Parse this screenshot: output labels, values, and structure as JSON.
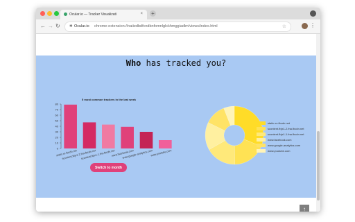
{
  "browser": {
    "tab_title": "Ocular.io — Tracker Visualizati",
    "tab_close": "×",
    "new_tab": "+",
    "omnibox_site": "Ocular.io",
    "omnibox_url": "chrome-extension://naiiedbdfcndbnfomnlglckhmggiadlm/views/index.html",
    "back": "←",
    "forward": "→",
    "reload": "↻",
    "star": "☆",
    "menu": "⋮"
  },
  "page": {
    "headline_bold": "Who",
    "headline_rest": " has tracked you?",
    "switch_button": "Switch to month",
    "scroll_top": "↑"
  },
  "colors": {
    "panel_bg": "#a9c9f3",
    "button": "#e0417a"
  },
  "chart_data": [
    {
      "type": "bar",
      "title": "5 most common trackers in the last week",
      "categories": [
        "static.xx.fbcdn.net",
        "scontent.fbjx1-2.fna.fbcdn.net",
        "scontent.fbjx1-1.fna.fbcdn.net",
        "www.facebook.com",
        "www.google-analytics.com",
        "www.youtube.com"
      ],
      "values": [
        79,
        47,
        43,
        39,
        30,
        15
      ],
      "colors": [
        "#e0417a",
        "#d42a63",
        "#f07aa2",
        "#e0417a",
        "#c42355",
        "#f0609a"
      ],
      "ylim": [
        0,
        80
      ],
      "yticks": [
        0,
        10,
        20,
        30,
        40,
        50,
        60,
        70,
        80
      ],
      "grid": false
    },
    {
      "type": "pie",
      "donut": true,
      "categories": [
        "static.xx.fbcdn.net",
        "scontent.fbjx1-2.fna.fbcdn.net",
        "scontent.fbjx1-1.fna.fbcdn.net",
        "www.facebook.com",
        "www.google-analytics.com",
        "www.youtube.com"
      ],
      "values": [
        79,
        47,
        43,
        39,
        30,
        15
      ],
      "colors": [
        "#ffdc28",
        "#ffe254",
        "#ffe97a",
        "#fff0a0",
        "#ffe366",
        "#fff4b8"
      ],
      "legend": "right"
    }
  ]
}
